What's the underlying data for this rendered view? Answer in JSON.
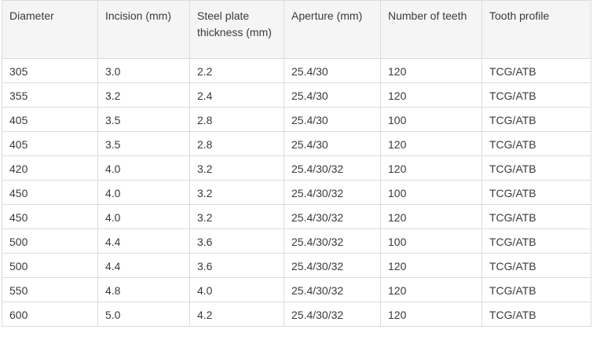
{
  "table": {
    "headers": [
      "Diameter",
      "Incision (mm)",
      "Steel plate thickness (mm)",
      "Aperture (mm)",
      "Number of teeth",
      "Tooth profile"
    ],
    "rows": [
      [
        "305",
        "3.0",
        "2.2",
        "25.4/30",
        "120",
        "TCG/ATB"
      ],
      [
        "355",
        "3.2",
        "2.4",
        "25.4/30",
        "120",
        "TCG/ATB"
      ],
      [
        "405",
        "3.5",
        "2.8",
        "25.4/30",
        "100",
        "TCG/ATB"
      ],
      [
        "405",
        "3.5",
        "2.8",
        "25.4/30",
        "120",
        "TCG/ATB"
      ],
      [
        "420",
        "4.0",
        "3.2",
        "25.4/30/32",
        "120",
        "TCG/ATB"
      ],
      [
        "450",
        "4.0",
        "3.2",
        "25.4/30/32",
        "100",
        "TCG/ATB"
      ],
      [
        "450",
        "4.0",
        "3.2",
        "25.4/30/32",
        "120",
        "TCG/ATB"
      ],
      [
        "500",
        "4.4",
        "3.6",
        "25.4/30/32",
        "100",
        "TCG/ATB"
      ],
      [
        "500",
        "4.4",
        "3.6",
        "25.4/30/32",
        "120",
        "TCG/ATB"
      ],
      [
        "550",
        "4.8",
        "4.0",
        "25.4/30/32",
        "120",
        "TCG/ATB"
      ],
      [
        "600",
        "5.0",
        "4.2",
        "25.4/30/32",
        "120",
        "TCG/ATB"
      ]
    ]
  }
}
